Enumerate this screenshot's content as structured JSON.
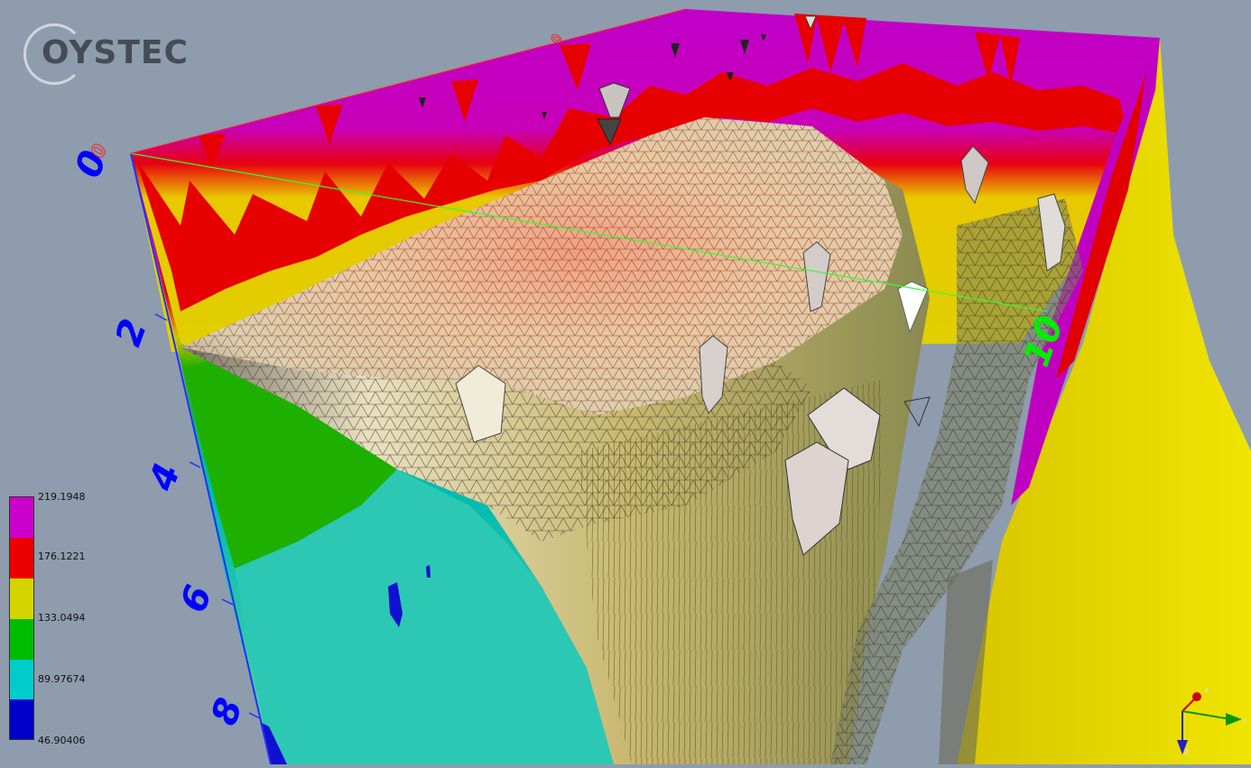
{
  "logo": {
    "text": "OYSTEC"
  },
  "legend": {
    "labels": [
      "219.1948",
      "176.1221",
      "133.0494",
      "89.97674",
      "46.90406"
    ],
    "colors": [
      "#cc00cc",
      "#ee0000",
      "#d4d400",
      "#00bb00",
      "#00cccc",
      "#0000cc"
    ]
  },
  "depth_axis": {
    "ticks": [
      "0",
      "2",
      "4",
      "6",
      "8"
    ],
    "color": "#0000ff"
  },
  "green_axis": {
    "tick": "10",
    "color": "#00cc00"
  },
  "red_axis": {
    "tick": "0",
    "color": "#ff0000"
  },
  "triad": {
    "x": "X",
    "y": "Y",
    "z": "Z"
  }
}
